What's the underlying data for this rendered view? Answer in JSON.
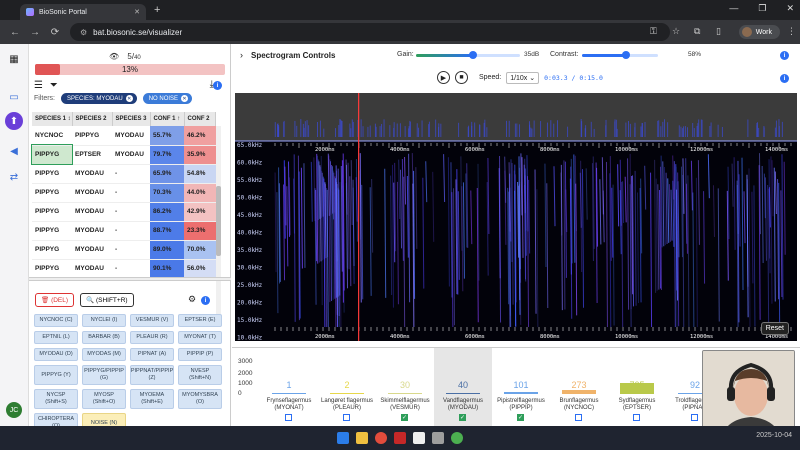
{
  "browser": {
    "tab_title": "BioSonic Portal",
    "new_tab_label": "+",
    "url": "bat.biosonic.se/visualizer",
    "profile_label": "Work"
  },
  "left_panel": {
    "count": "5/",
    "count_total": "40",
    "progress": {
      "percent": 13,
      "label": "13%"
    },
    "filters_label": "Filters:",
    "filter_chips": [
      "SPECIES: MYODAU",
      "NO NOISE"
    ],
    "table": {
      "headers": [
        "SPECIES 1 ↕",
        "SPECIES 2",
        "SPECIES 3",
        "CONF 1 ↑",
        "CONF 2"
      ],
      "rows": [
        {
          "s1": "NYCNOC",
          "s2": "PIPPYG",
          "s3": "MYODAU",
          "c1": "55.7%",
          "c2": "46.2%",
          "c1color": "#7f9fe8",
          "c2color": "#f0a0a0"
        },
        {
          "s1": "PIPPYG",
          "s2": "EPTSER",
          "s3": "MYODAU",
          "c1": "79.7%",
          "c2": "35.9%",
          "c1color": "#5b86ea",
          "c2color": "#ee8f8f"
        },
        {
          "s1": "PIPPYG",
          "s2": "MYODAU",
          "s3": "-",
          "c1": "65.9%",
          "c2": "54.8%",
          "c1color": "#6f93e8",
          "c2color": "#c9d6f3"
        },
        {
          "s1": "PIPPYG",
          "s2": "MYODAU",
          "s3": "-",
          "c1": "70.3%",
          "c2": "44.0%",
          "c1color": "#6890e8",
          "c2color": "#f1b6b6"
        },
        {
          "s1": "PIPPYG",
          "s2": "MYODAU",
          "s3": "-",
          "c1": "86.2%",
          "c2": "42.9%",
          "c1color": "#527fe8",
          "c2color": "#f3c2c2"
        },
        {
          "s1": "PIPPYG",
          "s2": "MYODAU",
          "s3": "-",
          "c1": "88.7%",
          "c2": "23.3%",
          "c1color": "#4d7be8",
          "c2color": "#ec6f6f"
        },
        {
          "s1": "PIPPYG",
          "s2": "MYODAU",
          "s3": "-",
          "c1": "89.0%",
          "c2": "70.0%",
          "c1color": "#4c7ae8",
          "c2color": "#a9c2f1"
        },
        {
          "s1": "PIPPYG",
          "s2": "MYODAU",
          "s3": "-",
          "c1": "90.1%",
          "c2": "56.0%",
          "c1color": "#4a79e8",
          "c2color": "#d4ddf5"
        }
      ]
    },
    "actions": {
      "delete_label": "(DEL)",
      "search_label": "(SHIFT+R)"
    },
    "species_buttons": [
      "NYCNOC (C)",
      "NYCLEI (I)",
      "VESMUR (V)",
      "EPTSER (E)",
      "EPTNIL (L)",
      "BARBAR (B)",
      "PLEAUR (R)",
      "MYONAT (T)",
      "MYODAU (D)",
      "MYODAS (M)",
      "PIPNAT (A)",
      "PIPPIP (P)",
      "PIPPYG (Y)",
      "PIPPYG/PIPPIP (G)",
      "PIPPNAT/PIPPIP (Z)",
      "NVESP (Shift+N)",
      "NYCSP (Shift+S)",
      "MYOSP (Shift+O)",
      "MYOEMA (Shift+E)",
      "MYOMYSBRA (O)",
      "CHIROPTERA (Q)",
      "NOISE (N)"
    ]
  },
  "spectrogram": {
    "section_title": "Spectrogram Controls",
    "gain_label": "Gain:",
    "gain_value": "35dB",
    "gain_fraction": 0.55,
    "contrast_label": "Contrast:",
    "contrast_value": "58%",
    "contrast_fraction": 0.58,
    "speed_label": "Speed:",
    "speed_value": "1/10x",
    "time_current": "0:03.3",
    "time_sep": "/",
    "time_total": "0:15.0",
    "freq_labels": [
      "65.0kHz",
      "60.0kHz",
      "55.0kHz",
      "50.0kHz",
      "45.0kHz",
      "40.0kHz",
      "35.0kHz",
      "30.0kHz",
      "25.0kHz",
      "20.0kHz",
      "15.0kHz",
      "10.0kHz"
    ],
    "time_labels": [
      "2000ms",
      "4000ms",
      "6000ms",
      "8000ms",
      "10000ms",
      "12000ms",
      "14000ms"
    ],
    "playhead_fraction": 0.22,
    "reset_label": "Reset"
  },
  "histogram": {
    "y_labels": [
      "3000",
      "2000",
      "1000",
      "0"
    ],
    "bars": [
      {
        "count": "1",
        "name": "Frynseflagermus",
        "code": "(MYONAT)",
        "color": "#6aa3e8",
        "checked": false
      },
      {
        "count": "2",
        "name": "Langøret flagermus",
        "code": "(PLEAUR)",
        "color": "#e7d84a",
        "checked": false
      },
      {
        "count": "30",
        "name": "Skimmelflagermus",
        "code": "(VESMUR)",
        "color": "#d9d98c",
        "checked": true
      },
      {
        "count": "40",
        "name": "Vandflagermus",
        "code": "(MYODAU)",
        "color": "#4a6fa5",
        "checked": true
      },
      {
        "count": "101",
        "name": "Pipistrelflagermus",
        "code": "(PIPPIP)",
        "color": "#6aa3e8",
        "checked": true
      },
      {
        "count": "273",
        "name": "Brunflagermus",
        "code": "(NYCNOC)",
        "color": "#f0b36a",
        "checked": false
      },
      {
        "count": "705",
        "name": "Sydflagermus",
        "code": "(EPTSER)",
        "color": "#b9c94a",
        "checked": false
      },
      {
        "count": "92",
        "name": "Troldflagermus",
        "code": "(PIPNAT)",
        "color": "#6aa3e8",
        "checked": false
      }
    ]
  },
  "user": {
    "initials": "JC"
  },
  "tray": {
    "date": "2025-10-04"
  }
}
